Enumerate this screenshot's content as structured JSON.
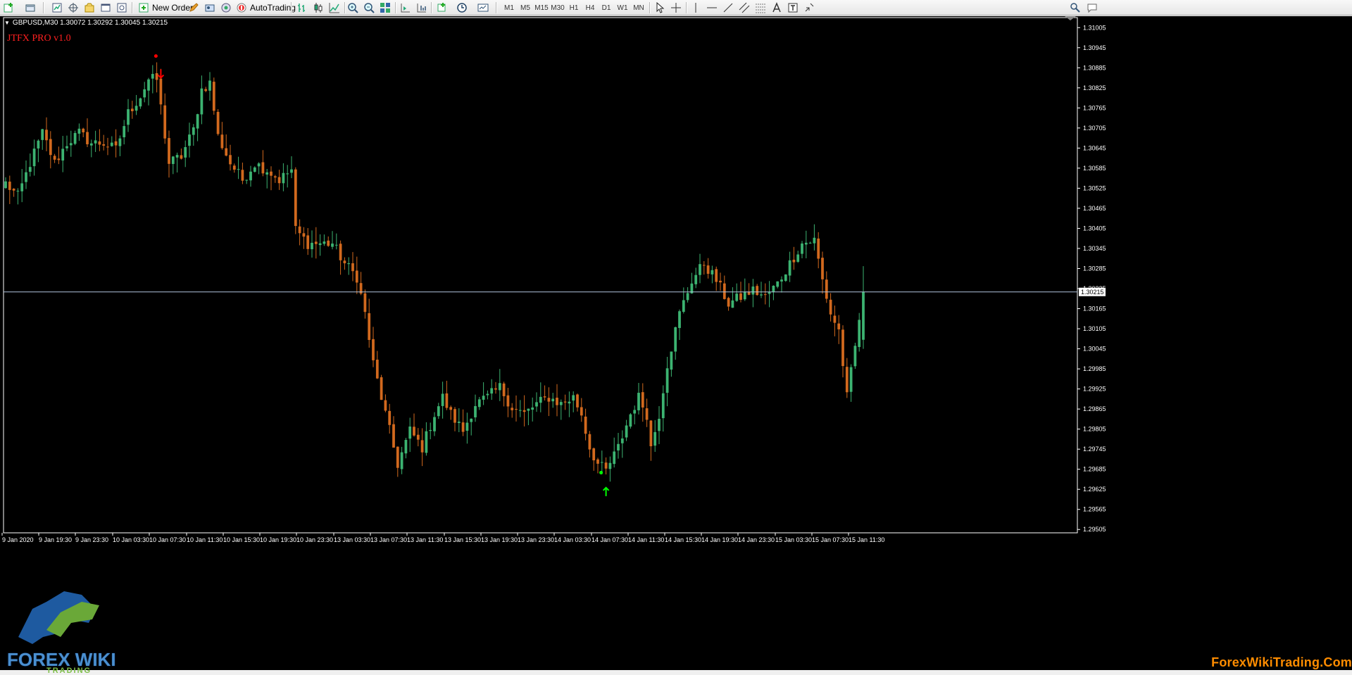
{
  "toolbar": {
    "new_order_label": "New Order",
    "autotrading_label": "AutoTrading",
    "timeframes": [
      "M1",
      "M5",
      "M15",
      "M30",
      "H1",
      "H4",
      "D1",
      "W1",
      "MN"
    ]
  },
  "chart": {
    "symbol_line": "GBPUSD,M30  1.30072 1.30292 1.30045 1.30215",
    "indicator_name": "JTFX PRO v1.0",
    "watermark": "ForexWikiTrading.Com",
    "logo_text": "FOREX WIKI",
    "logo_sub": "TRADING",
    "current_price_label": "1.30215"
  },
  "colors": {
    "background": "#000000",
    "bull_candle": "#3cb371",
    "bear_candle": "#d2691e",
    "axis_text": "#ffffff",
    "price_line": "#b0c4de",
    "sell_arrow": "#ff0000",
    "buy_arrow": "#00ff00",
    "indicator_label": "#ff2020",
    "watermark": "#ff8c00"
  },
  "chart_data": {
    "type": "candlestick",
    "symbol": "GBPUSD",
    "timeframe": "M30",
    "ohlc_header": {
      "open": 1.30072,
      "high": 1.30292,
      "low": 1.30045,
      "close": 1.30215
    },
    "y_ticks": [
      1.31005,
      1.30945,
      1.30885,
      1.30825,
      1.30765,
      1.30705,
      1.30645,
      1.30585,
      1.30525,
      1.30465,
      1.30405,
      1.30345,
      1.30285,
      1.30225,
      1.30165,
      1.30105,
      1.30045,
      1.29985,
      1.29925,
      1.29865,
      1.29805,
      1.29745,
      1.29685,
      1.29625,
      1.29565,
      1.29505
    ],
    "ylim": [
      1.29495,
      1.31035
    ],
    "current_price": 1.30215,
    "x_ticks": [
      "9 Jan 2020",
      "9 Jan 19:30",
      "9 Jan 23:30",
      "10 Jan 03:30",
      "10 Jan 07:30",
      "10 Jan 11:30",
      "10 Jan 15:30",
      "10 Jan 19:30",
      "10 Jan 23:30",
      "13 Jan 03:30",
      "13 Jan 07:30",
      "13 Jan 11:30",
      "13 Jan 15:30",
      "13 Jan 19:30",
      "13 Jan 23:30",
      "14 Jan 03:30",
      "14 Jan 07:30",
      "14 Jan 11:30",
      "14 Jan 15:30",
      "14 Jan 19:30",
      "14 Jan 23:30",
      "15 Jan 03:30",
      "15 Jan 07:30",
      "15 Jan 11:30"
    ],
    "anchor_closes": [
      [
        0,
        1.3054
      ],
      [
        3,
        1.305
      ],
      [
        6,
        1.306
      ],
      [
        9,
        1.3069
      ],
      [
        12,
        1.306
      ],
      [
        15,
        1.3066
      ],
      [
        18,
        1.3069
      ],
      [
        21,
        1.3066
      ],
      [
        24,
        1.3066
      ],
      [
        27,
        1.3064
      ],
      [
        30,
        1.3075
      ],
      [
        33,
        1.308
      ],
      [
        35,
        1.3085
      ],
      [
        37,
        1.3085
      ],
      [
        40,
        1.306
      ],
      [
        43,
        1.3062
      ],
      [
        46,
        1.307
      ],
      [
        48,
        1.3082
      ],
      [
        50,
        1.3084
      ],
      [
        52,
        1.3068
      ],
      [
        55,
        1.306
      ],
      [
        58,
        1.3055
      ],
      [
        61,
        1.306
      ],
      [
        64,
        1.3058
      ],
      [
        67,
        1.3055
      ],
      [
        70,
        1.3058
      ],
      [
        71,
        1.304
      ],
      [
        74,
        1.3036
      ],
      [
        77,
        1.3036
      ],
      [
        80,
        1.3036
      ],
      [
        83,
        1.303
      ],
      [
        86,
        1.3026
      ],
      [
        88,
        1.3015
      ],
      [
        90,
        1.3
      ],
      [
        92,
        1.299
      ],
      [
        94,
        1.298
      ],
      [
        96,
        1.297
      ],
      [
        99,
        1.298
      ],
      [
        102,
        1.2975
      ],
      [
        105,
        1.2985
      ],
      [
        107,
        1.299
      ],
      [
        109,
        1.2985
      ],
      [
        112,
        1.298
      ],
      [
        115,
        1.2988
      ],
      [
        118,
        1.299
      ],
      [
        121,
        1.2993
      ],
      [
        124,
        1.2987
      ],
      [
        127,
        1.2985
      ],
      [
        130,
        1.2988
      ],
      [
        133,
        1.299
      ],
      [
        136,
        1.2988
      ],
      [
        139,
        1.299
      ],
      [
        141,
        1.2985
      ],
      [
        143,
        1.2975
      ],
      [
        145,
        1.297
      ],
      [
        147,
        1.2968
      ],
      [
        150,
        1.2975
      ],
      [
        153,
        1.2985
      ],
      [
        155,
        1.299
      ],
      [
        157,
        1.2985
      ],
      [
        158,
        1.2975
      ],
      [
        160,
        1.2985
      ],
      [
        162,
        1.3
      ],
      [
        165,
        1.3015
      ],
      [
        168,
        1.3025
      ],
      [
        171,
        1.303
      ],
      [
        174,
        1.3025
      ],
      [
        177,
        1.3018
      ],
      [
        180,
        1.302
      ],
      [
        183,
        1.3022
      ],
      [
        186,
        1.302
      ],
      [
        189,
        1.3024
      ],
      [
        192,
        1.303
      ],
      [
        195,
        1.3036
      ],
      [
        198,
        1.3037
      ],
      [
        200,
        1.3025
      ],
      [
        202,
        1.3015
      ],
      [
        204,
        1.301
      ],
      [
        206,
        1.299
      ],
      [
        208,
        1.3005
      ],
      [
        210,
        1.3022
      ]
    ],
    "signals": [
      {
        "type": "sell",
        "bar": 38,
        "price": 1.30855,
        "dot_price": 1.3092
      },
      {
        "type": "buy",
        "bar": 147,
        "price": 1.2963,
        "dot_price": 1.29675
      }
    ]
  }
}
